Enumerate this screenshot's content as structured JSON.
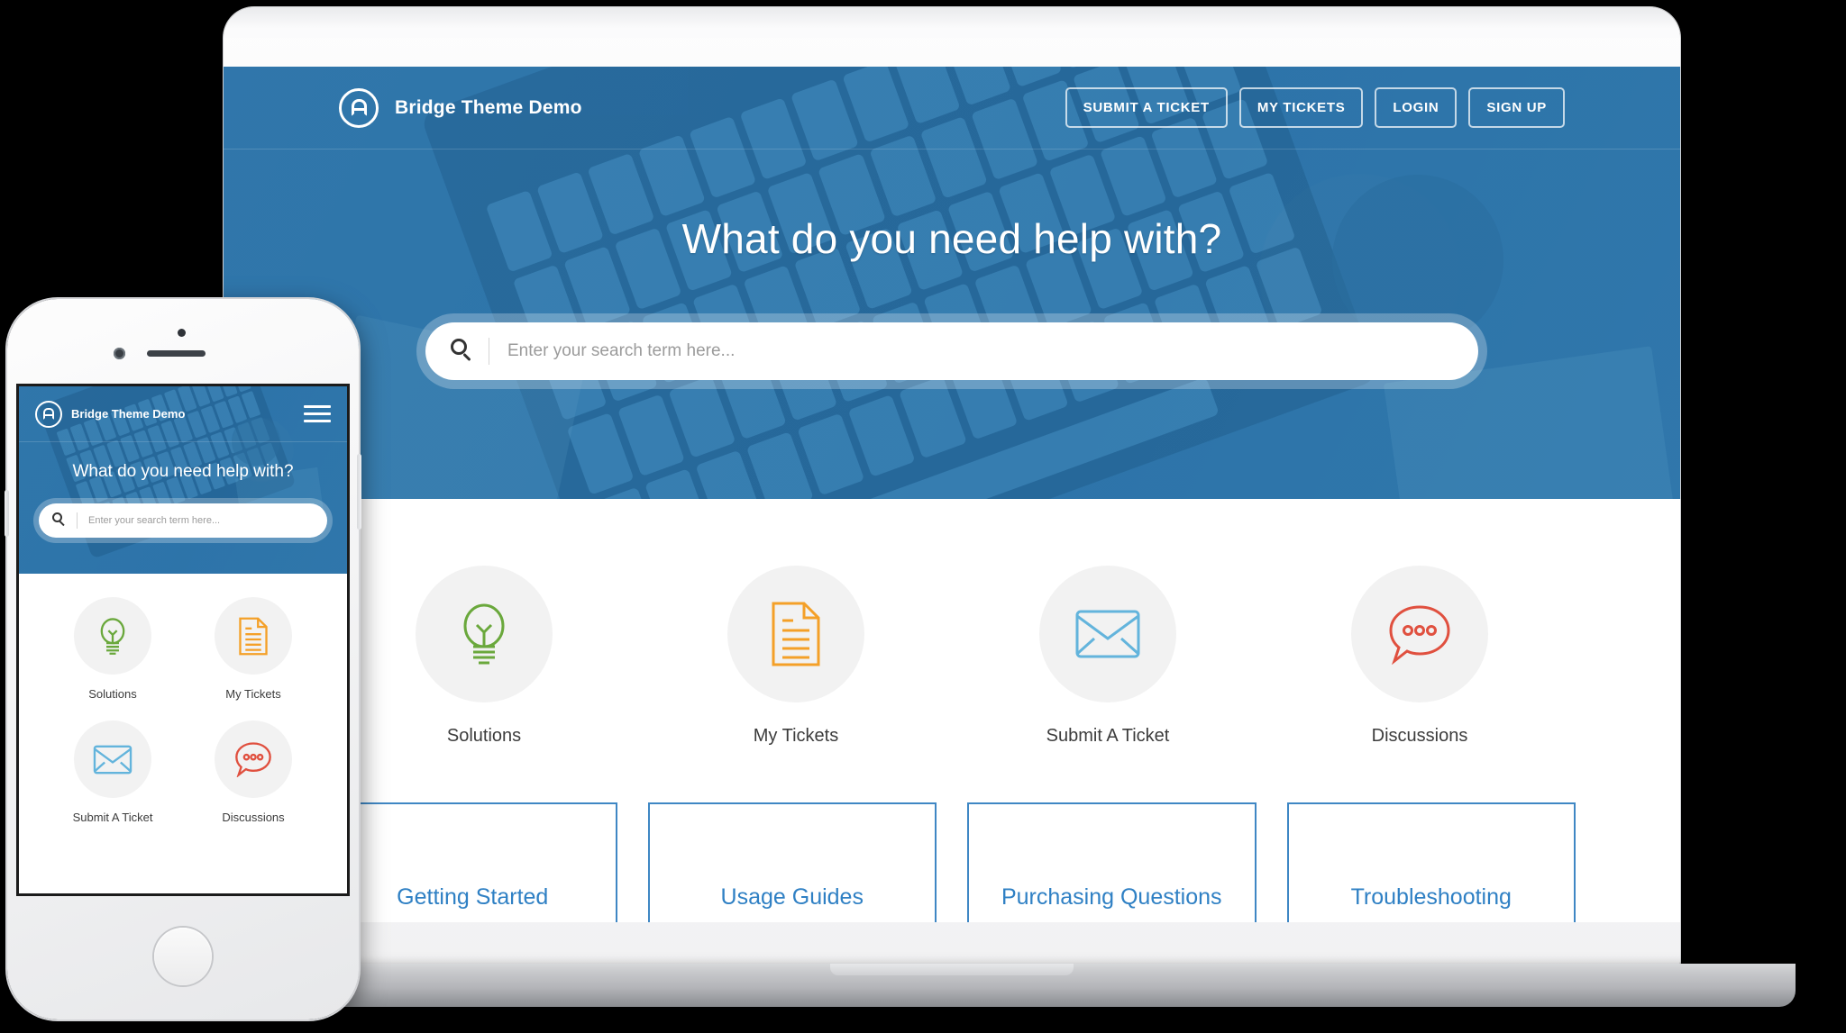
{
  "site": {
    "brand_name": "Bridge Theme Demo",
    "logo_icon": "circle-a-logo-icon",
    "nav": [
      {
        "label": "SUBMIT A TICKET",
        "name": "submit-a-ticket"
      },
      {
        "label": "MY TICKETS",
        "name": "my-tickets"
      },
      {
        "label": "LOGIN",
        "name": "login"
      },
      {
        "label": "SIGN UP",
        "name": "sign-up"
      }
    ],
    "hero": {
      "title": "What do you need help with?",
      "search_placeholder": "Enter your search term here...",
      "search_value": "",
      "search_icon": "magnifier-icon",
      "background_color": "#2d74a6"
    },
    "shortcuts": [
      {
        "label": "Solutions",
        "icon": "lightbulb-icon",
        "color": "#6aa83c"
      },
      {
        "label": "My Tickets",
        "icon": "document-icon",
        "color": "#f4a028"
      },
      {
        "label": "Submit A Ticket",
        "icon": "envelope-icon",
        "color": "#63b4dc"
      },
      {
        "label": "Discussions",
        "icon": "chat-bubble-icon",
        "color": "#e0503f"
      }
    ],
    "categories": [
      {
        "title": "Getting Started"
      },
      {
        "title": "Usage Guides"
      },
      {
        "title": "Purchasing Questions"
      },
      {
        "title": "Troubleshooting"
      }
    ],
    "accent_color": "#2f80c4",
    "card_border_color": "#3f87c4"
  },
  "mobile": {
    "brand_name": "Bridge Theme Demo",
    "logo_icon": "circle-a-logo-icon",
    "menu_icon": "hamburger-menu-icon",
    "hero": {
      "title": "What do you need help with?",
      "search_placeholder": "Enter your search term here...",
      "search_value": "",
      "search_icon": "magnifier-icon"
    },
    "shortcuts": [
      {
        "label": "Solutions",
        "icon": "lightbulb-icon",
        "color": "#6aa83c"
      },
      {
        "label": "My Tickets",
        "icon": "document-icon",
        "color": "#f4a028"
      },
      {
        "label": "Submit A Ticket",
        "icon": "envelope-icon",
        "color": "#63b4dc"
      },
      {
        "label": "Discussions",
        "icon": "chat-bubble-icon",
        "color": "#e0503f"
      }
    ]
  }
}
